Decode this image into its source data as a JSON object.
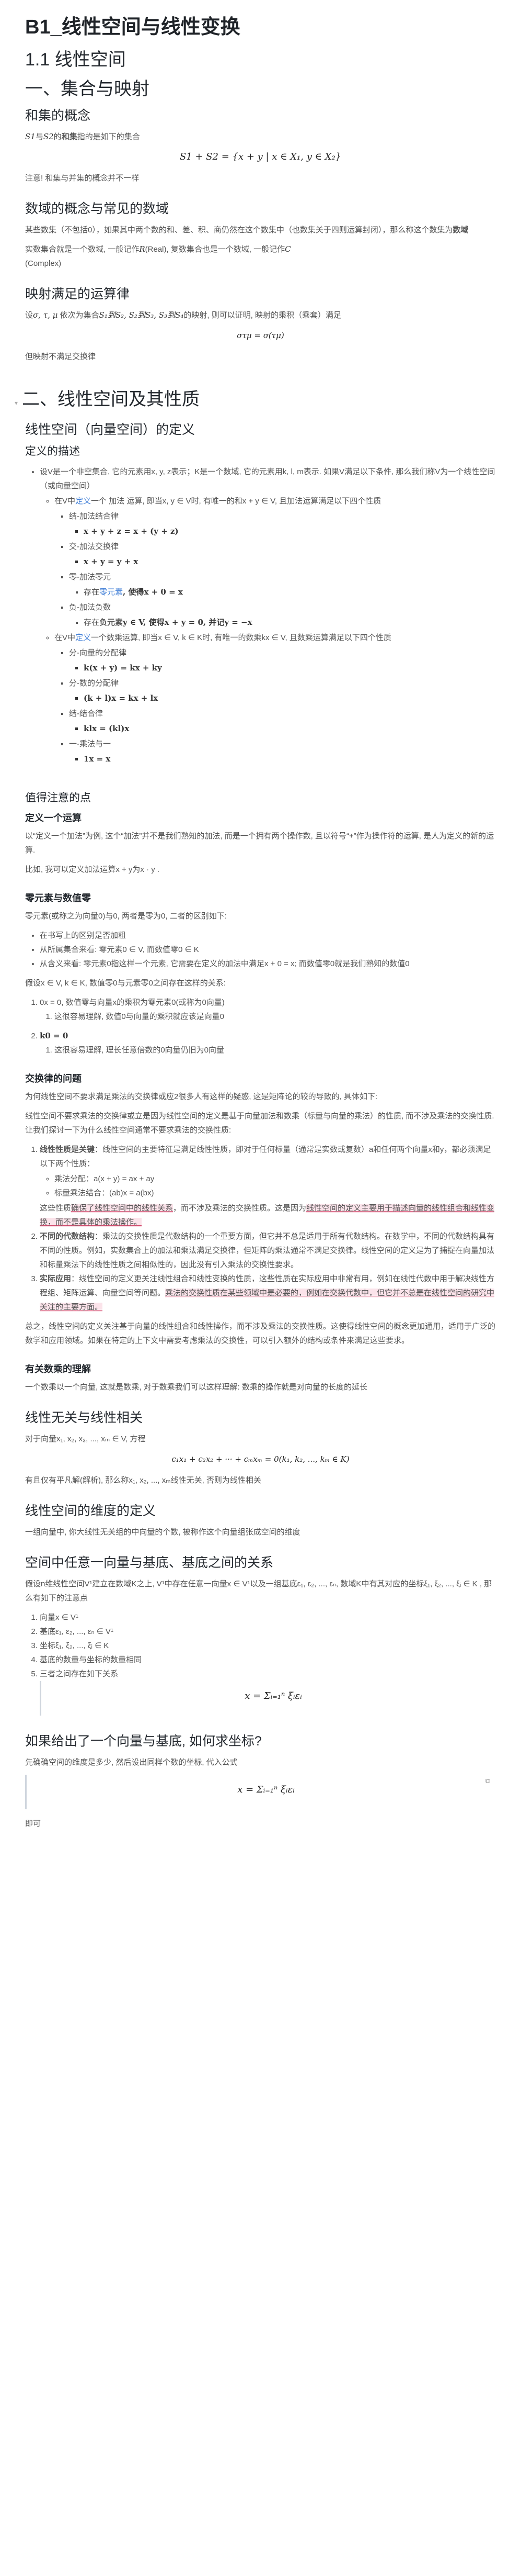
{
  "title": "B1_线性空间与线性变换",
  "h_1_1": "1.1 线性空间",
  "h_set": "一、集合与映射",
  "h_sum": "和集的概念",
  "p_sum_a": "S1",
  "p_sum_b": "与",
  "p_sum_c": "S2",
  "p_sum_d": "的",
  "p_sum_e": "和集",
  "p_sum_f": "指的是如下的集合",
  "eq_sum": "S1 + S2 = {x + y | x ∈ X₁, y ∈ X₂}",
  "p_note_sum": "注意! 和集与并集的概念并不一样",
  "h_numfield": "数域的概念与常见的数域",
  "p_nf1": "某些数集（不包括0），如果其中两个数的和、差、积、商仍然在这个数集中（也数集关于四则运算封闭），那么称这个数集为",
  "p_nf1_b": "数域",
  "p_nf2": "实数集合就是一个数域, 一般记作",
  "p_nf2_m1": "R",
  "p_nf2_b": "(Real), 复数集合也是一个数域, 一般记作",
  "p_nf2_m2": "C",
  "p_nf2_c": "(Complex)",
  "h_map": "映射满足的运算律",
  "p_map1": "设",
  "p_map1_m": "σ, τ, μ",
  "p_map1_b": " 依次为集合",
  "p_map1_c": "S₁到S₂, S₂到S₃, S₃到S₄",
  "p_map1_d": "的映射, 则可以证明, 映射的乘积（乘套）满足",
  "eq_map": "στμ = σ(τμ)",
  "p_map2": "但映射不满足交换律",
  "h_linsp": "二、线性空间及其性质",
  "h_lindef": "线性空间（向量空间）的定义",
  "h_defdesc": "定义的描述",
  "def_intro": "设V是一个非空集合, 它的元素用x, y, z表示；K是一个数域, 它的元素用k, l, m表示. 如果V满足以下条件, 那么我们称V为一个线性空间（或向量空间）",
  "def_add_a": "在V中",
  "def_add_link": "定义",
  "def_add_b": "一个 加法 运算, 即当x, y ∈ V时, 有唯一的和x + y ∈ V, 且加法运算满足以下四个性质",
  "def_add_items": [
    "结-加法结合律",
    "x + y + z = x + (y + z)",
    "交-加法交换律",
    "x + y = y + x",
    "零-加法零元",
    "存在",
    "零元素",
    ", 使得x + 0 = x",
    "负-加法负数",
    "存在",
    "负元素",
    "y ∈ V, 使得x + y = 0, 并记y = −x"
  ],
  "def_mul_a": "在V中",
  "def_mul_link": "定义",
  "def_mul_b": "一个数乘运算, 即当x ∈ V, k ∈ K时, 有唯一的数乘kx ∈ V, 且数乘运算满足以下四个性质",
  "def_mul_items": [
    "分-向量的分配律",
    "k(x + y) = kx + ky",
    "分-数的分配律",
    "(k + l)x = kx + lx",
    "结-结合律",
    "klx = (kl)x",
    "一-乘法与一",
    "1x = x"
  ],
  "h_notice": "值得注意的点",
  "h_defop": "定义一个运算",
  "p_defop1": "以“定义一个加法”为例, 这个“加法”并不是我们熟知的加法, 而是一个拥有两个操作数, 且以符号“+”作为操作符的运算, 是人为定义的新的运算.",
  "p_defop2": "比如, 我可以定义加法运算x + y为x · y .",
  "h_zero": "零元素与数值零",
  "p_zero1": "零元素(或称之为向量0)与0, 两者是零为0, 二者的区别如下:",
  "zero_list": [
    "在书写上的区别是否加粗",
    "从所属集合来看: 零元素0 ∈ V, 而数值零0 ∈ K",
    "从含义来看: 零元素0指这样一个元素, 它需要在定义的加法中满足x + 0 = x; 而数值零0就是我们熟知的数值0"
  ],
  "p_zero2": "假设x ∈ V, k ∈ K, 数值零0与元素零0之间存在这样的关系:",
  "zero_ol1": "0x = 0, 数值零与向量x的乘积为零元素0(或称为0向量)",
  "zero_ol1_sub": "这很容易理解, 数值0与向量的乘积就应该是向量0",
  "zero_ol2": "k0 = 0",
  "zero_ol2_sub": "这很容易理解, 理长任意倍数的0向量仍旧为0向量",
  "h_comm": "交换律的问题",
  "p_comm1": "为何线性空间不要求满足乘法的交换律或应2很多人有这样的疑惑, 这是矩阵论的较的导致的, 具体如下:",
  "p_comm2": "线性空间不要求乘法的交换律或立是因为线性空间的定义是基于向量加法和数乘（标量与向量的乘法）的性质, 而不涉及乘法的交换性质. 让我们探讨一下为什么线性空间通常不要求乘法的交换性质:",
  "comm_li1_b": "线性性质是关键",
  "comm_li1": "：线性空间的主要特征是满足线性性质，即对于任何标量（通常是实数或复数）a和任何两个向量x和y，都必须满足以下两个性质：",
  "comm_sub": [
    "乘法分配：a(x + y) = ax + ay",
    "标量乘法结合：(ab)x = a(bx)"
  ],
  "comm_li1_tail_a": "这些性质",
  "comm_li1_tail_hl": "确保了线性空间中的线性关系",
  "comm_li1_tail_b": "，而不涉及乘法的交换性质。这是因为",
  "comm_li1_tail_c": "线性空间的定义主要用于描述向量的线性组合和线性变换，而不是具体的乘法操作。",
  "comm_li2_b": "不同的代数结构",
  "comm_li2": "：乘法的交换性质是代数结构的一个重要方面，但它并不总是适用于所有代数结构。在数学中，不同的代数结构具有不同的性质。例如，实数集合上的加法和乘法满足交换律，但矩阵的乘法通常不满足交换律。线性空间的定义是为了捕捉在向量加法和标量乘法下的线性性质之间相似性的，因此没有引入乘法的交换性要求。",
  "comm_li3_b": "实际应用",
  "comm_li3_a": "：线性空间的定义更关注线性组合和线性变换的性质，这些性质在实际应用中非常有用，例如在线性代数中用于解决线性方程组、矩阵运算、向量空间等问题。",
  "comm_li3_c": "乘法的交换性质在某些领域中是必要的，例如在交换代数中，但它并不总是在线性空间的研究中关注的主要方面。",
  "p_comm3": "总之，线性空间的定义关注基于向量的线性组合和线性操作，而不涉及乘法的交换性质。这使得线性空间的概念更加通用，适用于广泛的数学和应用领域。如果在特定的上下文中需要考虑乘法的交换性，可以引入额外的结构或条件来满足这些要求。",
  "h_vecnum": "有关数乘的理解",
  "p_vecnum": "一个数乘以一个向量, 这就是数乘, 对于数乘我们可以这样理解: 数乘的操作就是对向量的长度的延长",
  "h_lindep": "线性无关与线性相关",
  "p_lindep1": "对于向量x₁, x₂, x₃, ..., xₘ ∈ V, 方程",
  "eq_lindep": "c₁x₁ + c₂x₂ + ··· + cₘxₘ = 0(k₁, k₂, ..., kₘ ∈ K)",
  "p_lindep2": "有且仅有平凡解(解析), 那么称x₁, x₂, ..., xₘ线性无关, 否则为线性相关",
  "h_dim": "线性空间的维度的定义",
  "p_dim": "一组向量中, 你大线性无关组的中向量的个数, 被称作这个向量组张成空间的维度",
  "h_basis": "空间中任意一向量与基底、基底之间的关系",
  "p_basis1": "假设n维线性空间V¹建立在数域K之上, V¹中存在任意一向量x ∈ V¹以及一组基底ε₁, ε₂, ..., εₙ, 数域K中有其对应的坐标ξ₁, ξ₂, ..., ξᵢ ∈ K , 那么有如下的注意点",
  "basis_list": [
    "向量x ∈ V¹",
    "基底ε₁, ε₂, ..., εₙ ∈ V¹",
    "坐标ξ₁, ξ₂, ..., ξᵢ ∈ K",
    "基底的数量与坐标的数量相同",
    "三者之间存在如下关系"
  ],
  "eq_basis": "x = Σᵢ₌₁ⁿ ξᵢεᵢ",
  "h_find": "如果给出了一个向量与基底, 如何求坐标?",
  "p_find1": "先确确空间的维度是多少, 然后设出同样个数的坐标, 代入公式",
  "eq_find": "x = Σᵢ₌₁ⁿ ξᵢεᵢ",
  "p_find2": "即可",
  "code_copy_icon": "copy-icon"
}
